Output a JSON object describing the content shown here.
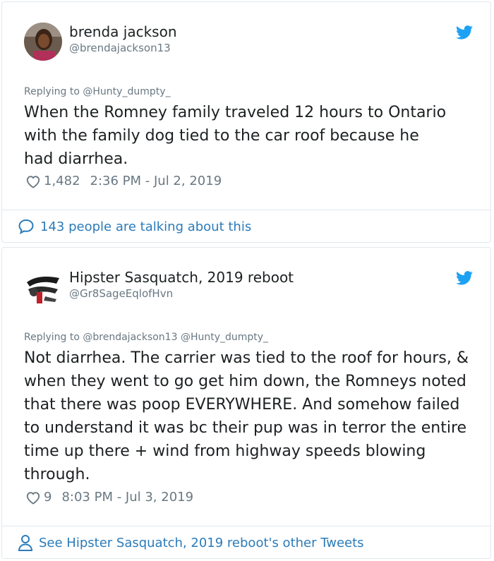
{
  "tweets": [
    {
      "name": "brenda jackson",
      "handle": "@brendajackson13",
      "replying_label": "Replying to",
      "replying_to": "@Hunty_dumpty_",
      "text": "When the Romney family traveled 12 hours to Ontario with the family dog tied to the car roof because he had diarrhea.",
      "likes": "1,482",
      "timestamp": "2:36 PM - Jul 2, 2019",
      "footer": "143 people are talking about this"
    },
    {
      "name": "Hipster Sasquatch, 2019 reboot",
      "handle": "@Gr8SageEqlofHvn",
      "replying_label": "Replying to",
      "replying_to": "@brendajackson13 @Hunty_dumpty_",
      "text": "Not diarrhea. The carrier was tied to the roof for hours, & when they went to go get him down, the Romneys noted that there was poop EVERYWHERE. And somehow failed to understand it was bc their pup was in terror the entire time up there + wind from highway speeds blowing through.",
      "likes": "9",
      "timestamp": "8:03 PM - Jul 3, 2019",
      "footer": "See Hipster Sasquatch, 2019 reboot's other Tweets"
    }
  ],
  "colors": {
    "link": "#2b7bb9",
    "muted": "#697882",
    "border": "#e1e8ed",
    "twitter_blue": "#1da1f2"
  },
  "icons": [
    "twitter-bird-icon",
    "heart-icon",
    "speech-bubble-icon",
    "person-icon"
  ]
}
